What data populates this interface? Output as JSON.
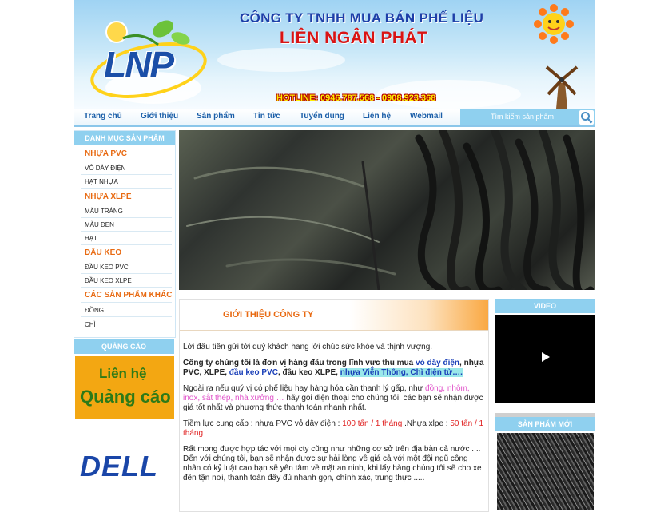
{
  "header": {
    "company_line1": "CÔNG TY TNHH MUA BÁN PHẾ LIỆU",
    "company_line2": "LIÊN NGÂN PHÁT",
    "logo_text": "LNP",
    "hotline": "HOTLINE: 0946.787.568 - 0908.923.368"
  },
  "nav": {
    "items": [
      "Trang chủ",
      "Giới thiệu",
      "Sản phẩm",
      "Tin tức",
      "Tuyển dụng",
      "Liên hệ",
      "Webmail"
    ],
    "search_placeholder": "Tìm kiếm sản phẩm"
  },
  "sidebar": {
    "title": "DANH MỤC SẢN PHẨM",
    "groups": [
      {
        "name": "NHỰA PVC",
        "items": [
          "VỎ DÂY ĐIỆN",
          "HẠT NHỰA"
        ]
      },
      {
        "name": "NHỰA XLPE",
        "items": [
          "MÀU TRẮNG",
          "MÀU ĐEN",
          "HẠT"
        ]
      },
      {
        "name": "ĐẦU KEO",
        "items": [
          "ĐẦU KEO PVC",
          "ĐẦU KEO XLPE"
        ]
      },
      {
        "name": "CÁC SẢN PHẨM KHÁC",
        "items": [
          "ĐỒNG",
          "CHÌ"
        ]
      }
    ]
  },
  "ads": {
    "title": "QUẢNG CÁO",
    "banner_line1": "Liên hệ",
    "banner_line2": "Quảng cáo",
    "brand": "DELL"
  },
  "intro": {
    "title": "GIỚI THIỆU CÔNG TY",
    "p1": "Lời đầu tiên gửi tới quý khách hang lời chúc sức khỏe và thịnh vượng.",
    "p2_a": "Công ty chúng tôi là đơn vị hàng đầu trong lĩnh vực thu mua ",
    "p2_b": "vỏ dây điện",
    "p2_c": ", nhựa PVC, XLPE, ",
    "p2_d": "đầu keo PVC",
    "p2_e": ", đầu keo XLPE, ",
    "p2_f": "nhựa Viễn Thông, Chì điện tử….",
    "p3_a": "Ngoài ra nếu quý vị có phế liệu hay hàng hóa cần thanh lý gấp, như  ",
    "p3_b": "đồng, nhôm, inox, sắt thép, nhà xưởng …",
    "p3_c": " hãy gọi điện thoại cho chúng tôi, các bạn sẽ nhận được giá tốt nhất và phương thức thanh toán nhanh nhất.",
    "p4_a": "Tiềm lực cung cấp : nhựa PVC vỏ dây điện : ",
    "p4_b": "100 tấn / 1 tháng",
    "p4_c": " .Nhựa xlpe : ",
    "p4_d": "50 tấn / 1 tháng",
    "p5": "Rất mong được hợp tác với mọi cty cũng như những cơ sở trên địa bàn cả nước .... Đến với chúng tôi, bạn sẽ nhận được sự hài lòng về giá cả với một đội ngũ công nhân có kỷ luật cao bạn sẽ yên tâm về mặt an ninh, khi lấy hàng chúng tôi sẽ cho xe đến tận nơi, thanh toán đầy đủ nhanh gọn, chính xác, trung thực ....."
  },
  "right": {
    "video_title": "VIDEO",
    "new_products_title": "SẢN PHẨM MỚI"
  }
}
